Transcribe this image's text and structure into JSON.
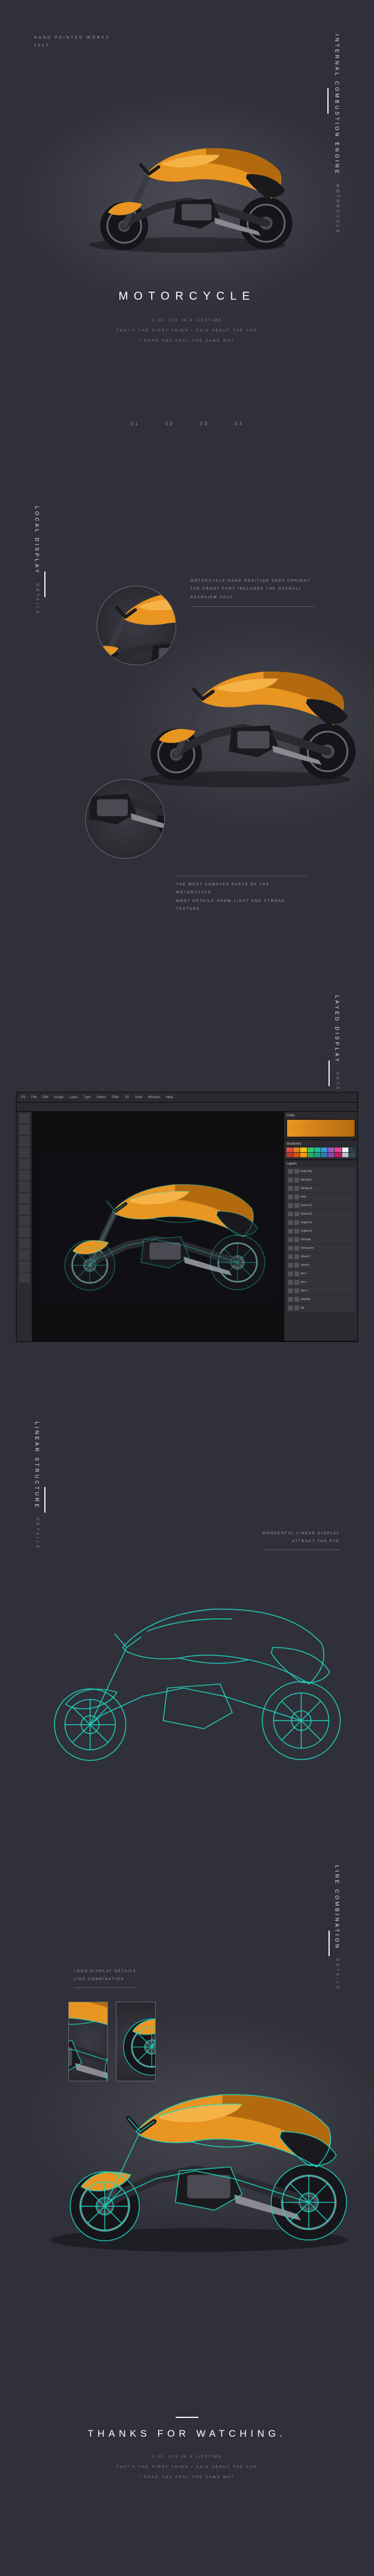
{
  "meta": {
    "works": "HAND PAINTED WORKS",
    "year": "2017"
  },
  "hero": {
    "title_main": "INTERNAL COMBUSTION ENGINE",
    "title_sub": "MOTORCYCLE",
    "heading": "MOTORCYCLE",
    "line1": "1:30, 570 IN A LIFETIME",
    "line2": "THAT'S THE FIRST THING I SAID ABOUT THE CAR",
    "line3": "I HOPE YOU FEEL THE SAME WAY",
    "numbers": {
      "n1": "01",
      "n2": "02",
      "n3": "03",
      "n4": "04"
    }
  },
  "local": {
    "title": "LOCAL DISPLAY",
    "sub": "DETAILS",
    "anno1a": "MOTORCYCLE HAND POSITION VERY UPRIGHT",
    "anno1b": "THE FRONT PART INCLUDES THE OVERALL REARVIEW COAT",
    "anno2a": "THE MOST COMPLEX PARTS OF THE MOTORCYCLE",
    "anno2b": "MOST DETAILS SHOW LIGHT AND STRONG TEXTURE"
  },
  "layered": {
    "title": "LAYED DISPLAY",
    "sub": "DETAILS",
    "ps": {
      "menus": [
        "PS",
        "File",
        "Edit",
        "Image",
        "Layer",
        "Type",
        "Select",
        "Filter",
        "3D",
        "View",
        "Window",
        "Help"
      ],
      "panel_color": "Color",
      "panel_swatches": "Swatches",
      "panel_layers": "Layers",
      "layers": [
        "body-top",
        "fairing-hl",
        "fairing-sh",
        "tank",
        "frame-01",
        "frame-02",
        "engine-a",
        "engine-b",
        "exhaust",
        "swing-arm",
        "wheel-f",
        "wheel-r",
        "tire-f",
        "tire-r",
        "disc-f",
        "shadow",
        "bg"
      ]
    }
  },
  "linear": {
    "title": "LINEAR STRUCTURE",
    "sub": "DETAILS",
    "anno1": "WONDERFUL LINEAR DISPLAY",
    "anno2": "ATTRACT THE EYE"
  },
  "linecomb": {
    "title": "LINE COMBINATION",
    "sub": "DETAILS",
    "anno1": "LOGO DISPLAY DETAILS",
    "anno2": "LINE COMBINATION"
  },
  "footer": {
    "heading": "THANKS FOR WATCHING.",
    "line1": "1:30, 570 IN A LIFETIME",
    "line2": "THAT'S THE FIRST THING I SAID ABOUT THE CAR",
    "line3": "I HOPE YOU FEEL THE SAME WAY"
  },
  "swatches": [
    "#e74c3c",
    "#e67e22",
    "#f1c40f",
    "#2ecc71",
    "#1abc9c",
    "#3498db",
    "#9b59b6",
    "#e84393",
    "#ecf0f1",
    "#2c3e50",
    "#c0392b",
    "#d35400",
    "#f39c12",
    "#27ae60",
    "#16a085",
    "#2980b9",
    "#8e44ad",
    "#c2185b",
    "#bdc3c7",
    "#34495e"
  ]
}
